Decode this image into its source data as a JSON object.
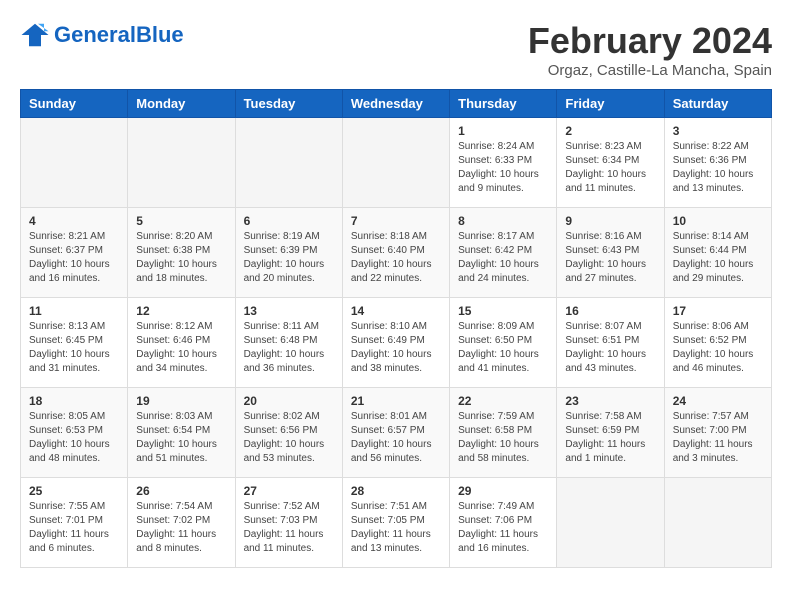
{
  "header": {
    "logo_general": "General",
    "logo_blue": "Blue",
    "title": "February 2024",
    "subtitle": "Orgaz, Castille-La Mancha, Spain"
  },
  "weekdays": [
    "Sunday",
    "Monday",
    "Tuesday",
    "Wednesday",
    "Thursday",
    "Friday",
    "Saturday"
  ],
  "weeks": [
    [
      {
        "day": "",
        "info": ""
      },
      {
        "day": "",
        "info": ""
      },
      {
        "day": "",
        "info": ""
      },
      {
        "day": "",
        "info": ""
      },
      {
        "day": "1",
        "info": "Sunrise: 8:24 AM\nSunset: 6:33 PM\nDaylight: 10 hours\nand 9 minutes."
      },
      {
        "day": "2",
        "info": "Sunrise: 8:23 AM\nSunset: 6:34 PM\nDaylight: 10 hours\nand 11 minutes."
      },
      {
        "day": "3",
        "info": "Sunrise: 8:22 AM\nSunset: 6:36 PM\nDaylight: 10 hours\nand 13 minutes."
      }
    ],
    [
      {
        "day": "4",
        "info": "Sunrise: 8:21 AM\nSunset: 6:37 PM\nDaylight: 10 hours\nand 16 minutes."
      },
      {
        "day": "5",
        "info": "Sunrise: 8:20 AM\nSunset: 6:38 PM\nDaylight: 10 hours\nand 18 minutes."
      },
      {
        "day": "6",
        "info": "Sunrise: 8:19 AM\nSunset: 6:39 PM\nDaylight: 10 hours\nand 20 minutes."
      },
      {
        "day": "7",
        "info": "Sunrise: 8:18 AM\nSunset: 6:40 PM\nDaylight: 10 hours\nand 22 minutes."
      },
      {
        "day": "8",
        "info": "Sunrise: 8:17 AM\nSunset: 6:42 PM\nDaylight: 10 hours\nand 24 minutes."
      },
      {
        "day": "9",
        "info": "Sunrise: 8:16 AM\nSunset: 6:43 PM\nDaylight: 10 hours\nand 27 minutes."
      },
      {
        "day": "10",
        "info": "Sunrise: 8:14 AM\nSunset: 6:44 PM\nDaylight: 10 hours\nand 29 minutes."
      }
    ],
    [
      {
        "day": "11",
        "info": "Sunrise: 8:13 AM\nSunset: 6:45 PM\nDaylight: 10 hours\nand 31 minutes."
      },
      {
        "day": "12",
        "info": "Sunrise: 8:12 AM\nSunset: 6:46 PM\nDaylight: 10 hours\nand 34 minutes."
      },
      {
        "day": "13",
        "info": "Sunrise: 8:11 AM\nSunset: 6:48 PM\nDaylight: 10 hours\nand 36 minutes."
      },
      {
        "day": "14",
        "info": "Sunrise: 8:10 AM\nSunset: 6:49 PM\nDaylight: 10 hours\nand 38 minutes."
      },
      {
        "day": "15",
        "info": "Sunrise: 8:09 AM\nSunset: 6:50 PM\nDaylight: 10 hours\nand 41 minutes."
      },
      {
        "day": "16",
        "info": "Sunrise: 8:07 AM\nSunset: 6:51 PM\nDaylight: 10 hours\nand 43 minutes."
      },
      {
        "day": "17",
        "info": "Sunrise: 8:06 AM\nSunset: 6:52 PM\nDaylight: 10 hours\nand 46 minutes."
      }
    ],
    [
      {
        "day": "18",
        "info": "Sunrise: 8:05 AM\nSunset: 6:53 PM\nDaylight: 10 hours\nand 48 minutes."
      },
      {
        "day": "19",
        "info": "Sunrise: 8:03 AM\nSunset: 6:54 PM\nDaylight: 10 hours\nand 51 minutes."
      },
      {
        "day": "20",
        "info": "Sunrise: 8:02 AM\nSunset: 6:56 PM\nDaylight: 10 hours\nand 53 minutes."
      },
      {
        "day": "21",
        "info": "Sunrise: 8:01 AM\nSunset: 6:57 PM\nDaylight: 10 hours\nand 56 minutes."
      },
      {
        "day": "22",
        "info": "Sunrise: 7:59 AM\nSunset: 6:58 PM\nDaylight: 10 hours\nand 58 minutes."
      },
      {
        "day": "23",
        "info": "Sunrise: 7:58 AM\nSunset: 6:59 PM\nDaylight: 11 hours\nand 1 minute."
      },
      {
        "day": "24",
        "info": "Sunrise: 7:57 AM\nSunset: 7:00 PM\nDaylight: 11 hours\nand 3 minutes."
      }
    ],
    [
      {
        "day": "25",
        "info": "Sunrise: 7:55 AM\nSunset: 7:01 PM\nDaylight: 11 hours\nand 6 minutes."
      },
      {
        "day": "26",
        "info": "Sunrise: 7:54 AM\nSunset: 7:02 PM\nDaylight: 11 hours\nand 8 minutes."
      },
      {
        "day": "27",
        "info": "Sunrise: 7:52 AM\nSunset: 7:03 PM\nDaylight: 11 hours\nand 11 minutes."
      },
      {
        "day": "28",
        "info": "Sunrise: 7:51 AM\nSunset: 7:05 PM\nDaylight: 11 hours\nand 13 minutes."
      },
      {
        "day": "29",
        "info": "Sunrise: 7:49 AM\nSunset: 7:06 PM\nDaylight: 11 hours\nand 16 minutes."
      },
      {
        "day": "",
        "info": ""
      },
      {
        "day": "",
        "info": ""
      }
    ]
  ]
}
